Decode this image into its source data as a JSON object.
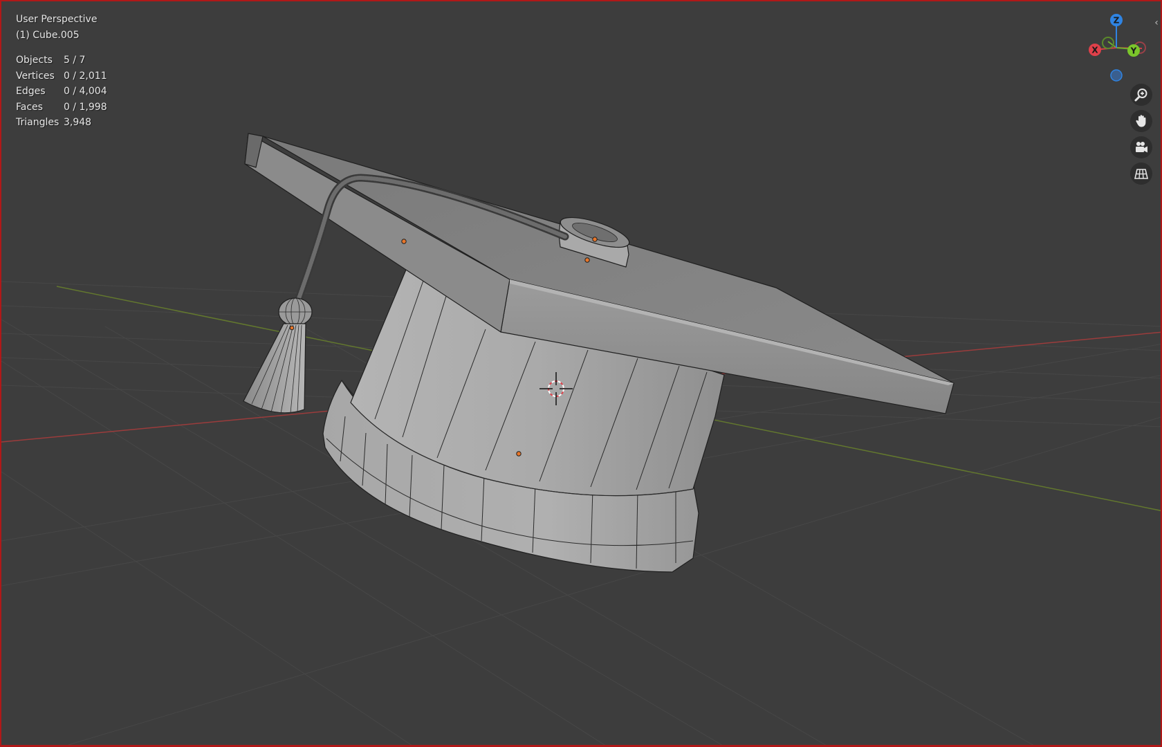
{
  "viewport": {
    "view_name": "User Perspective",
    "active_object": "(1) Cube.005",
    "stats": [
      {
        "label": "Objects",
        "value": "5 / 7"
      },
      {
        "label": "Vertices",
        "value": "0 / 2,011"
      },
      {
        "label": "Edges",
        "value": "0 / 4,004"
      },
      {
        "label": "Faces",
        "value": "0 / 1,998"
      },
      {
        "label": "Triangles",
        "value": "3,948"
      }
    ]
  },
  "gizmo": {
    "x_label": "X",
    "y_label": "Y",
    "z_label": "Z",
    "colors": {
      "x": "#e0404a",
      "y": "#7bc62b",
      "z": "#2f84e3",
      "neg_x": "#9a4048",
      "neg_y": "#5b8a2a",
      "neg_z": "#3a5f8f"
    }
  },
  "nav_buttons": [
    {
      "name": "zoom-button",
      "icon": "magnifier-plus-icon"
    },
    {
      "name": "pan-button",
      "icon": "hand-icon"
    },
    {
      "name": "camera-view-button",
      "icon": "video-camera-icon"
    },
    {
      "name": "ortho-toggle-button",
      "icon": "grid-icon"
    }
  ],
  "colors": {
    "background": "#3d3d3d",
    "grid_line": "#474747",
    "x_axis": "#9c3c3c",
    "y_axis": "#63782e",
    "mesh": "#9e9e9e",
    "origin_dot": "#e8762a",
    "border": "#b01818"
  },
  "collapse_arrow": "‹"
}
